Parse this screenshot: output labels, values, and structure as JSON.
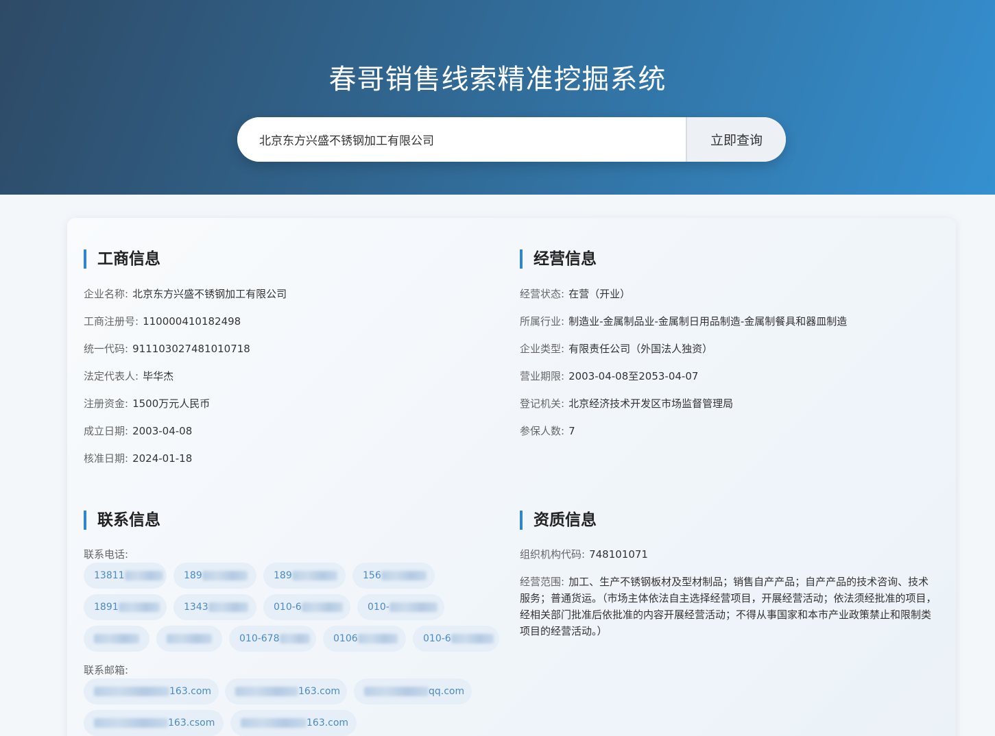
{
  "header": {
    "title": "春哥销售线索精准挖掘系统",
    "search_value": "北京东方兴盛不锈钢加工有限公司",
    "search_button": "立即查询"
  },
  "business": {
    "title": "工商信息",
    "fields": [
      {
        "label": "企业名称:",
        "value": "北京东方兴盛不锈钢加工有限公司"
      },
      {
        "label": "工商注册号:",
        "value": "110000410182498"
      },
      {
        "label": "统一代码:",
        "value": "911103027481010718"
      },
      {
        "label": "法定代表人:",
        "value": "毕华杰"
      },
      {
        "label": "注册资金:",
        "value": "1500万元人民币"
      },
      {
        "label": "成立日期:",
        "value": "2003-04-08"
      },
      {
        "label": "核准日期:",
        "value": "2024-01-18"
      }
    ]
  },
  "operation": {
    "title": "经营信息",
    "fields": [
      {
        "label": "经营状态:",
        "value": "在营（开业）"
      },
      {
        "label": "所属行业:",
        "value": "制造业-金属制品业-金属制日用品制造-金属制餐具和器皿制造"
      },
      {
        "label": "企业类型:",
        "value": "有限责任公司（外国法人独资）"
      },
      {
        "label": "营业期限:",
        "value": "2003-04-08至2053-04-07"
      },
      {
        "label": "登记机关:",
        "value": "北京经济技术开发区市场监督管理局"
      },
      {
        "label": "参保人数:",
        "value": "7"
      }
    ]
  },
  "contact": {
    "title": "联系信息",
    "phone_label": "联系电话:",
    "phones": [
      "13811",
      "189",
      "189",
      "156",
      "1891",
      "1343",
      "010-6",
      "010-",
      "",
      "",
      "010-678",
      "0106",
      "010-6"
    ],
    "email_label": "联系邮箱:",
    "emails": [
      "163.com",
      "163.com",
      "qq.com",
      "163.csom",
      "163.com"
    ]
  },
  "qualification": {
    "title": "资质信息",
    "org_code_label": "组织机构代码:",
    "org_code": "748101071",
    "scope_label": "经营范围:",
    "scope": "加工、生产不锈钢板材及型材制品；销售自产产品；自产产品的技术咨询、技术服务；普通货运。（市场主体依法自主选择经营项目，开展经营活动；依法须经批准的项目，经相关部门批准后依批准的内容开展经营活动；不得从事国家和本市产业政策禁止和限制类项目的经营活动。）"
  }
}
